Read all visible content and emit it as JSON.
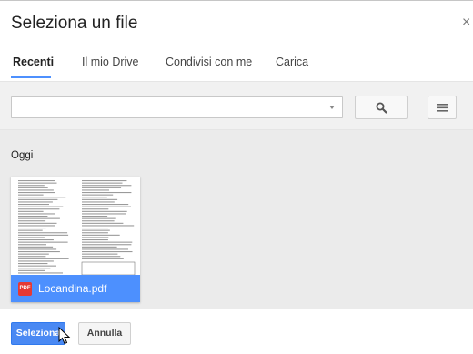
{
  "dialog": {
    "title": "Seleziona un file",
    "close_label": "×"
  },
  "tabs": [
    {
      "label": "Recenti",
      "active": true
    },
    {
      "label": "Il mio Drive",
      "active": false
    },
    {
      "label": "Condivisi con me",
      "active": false
    },
    {
      "label": "Carica",
      "active": false
    }
  ],
  "toolbar": {
    "search_value": "",
    "search_icon": "magnifier-icon",
    "view_icon": "list-view-icon"
  },
  "content": {
    "section_label": "Oggi",
    "files": [
      {
        "name": "Locandina.pdf",
        "type_badge": "PDF",
        "selected": true,
        "icon": "pdf-icon"
      }
    ]
  },
  "footer": {
    "select_label": "Seleziona",
    "cancel_label": "Annulla"
  },
  "colors": {
    "accent": "#4d90fe",
    "primary_button": "#4a89f3",
    "pdf_badge": "#e53935",
    "content_bg": "#ebebeb"
  }
}
